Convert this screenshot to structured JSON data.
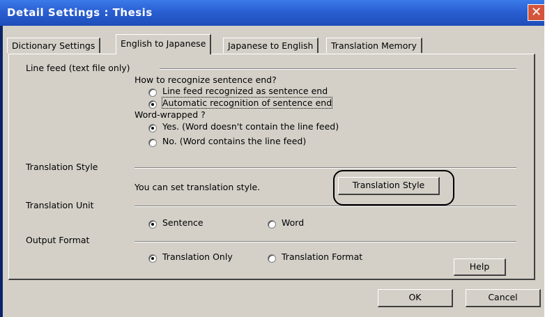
{
  "window": {
    "title": "Detail Settings : Thesis",
    "close_glyph": "✕"
  },
  "tabs": [
    {
      "label": "Dictionary Settings"
    },
    {
      "label": "English to Japanese"
    },
    {
      "label": "Japanese to English"
    },
    {
      "label": "Translation Memory"
    }
  ],
  "line_feed": {
    "group_label": "Line feed (text file only)",
    "question1": "How to recognize sentence end?",
    "opt1": "Line feed recognized as sentence end",
    "opt2": "Automatic recognition of sentence end",
    "question2": "Word-wrapped ?",
    "opt3": "Yes. (Word doesn't contain the line feed)",
    "opt4": "No. (Word contains the line feed)"
  },
  "translation_style": {
    "group_label": "Translation Style",
    "description": "You can set translation style.",
    "button_label": "Translation Style"
  },
  "translation_unit": {
    "group_label": "Translation Unit",
    "opt_sentence": "Sentence",
    "opt_word": "Word"
  },
  "output_format": {
    "group_label": "Output Format",
    "opt_only": "Translation Only",
    "opt_format": "Translation Format"
  },
  "buttons": {
    "help": "Help",
    "ok": "OK",
    "cancel": "Cancel"
  }
}
